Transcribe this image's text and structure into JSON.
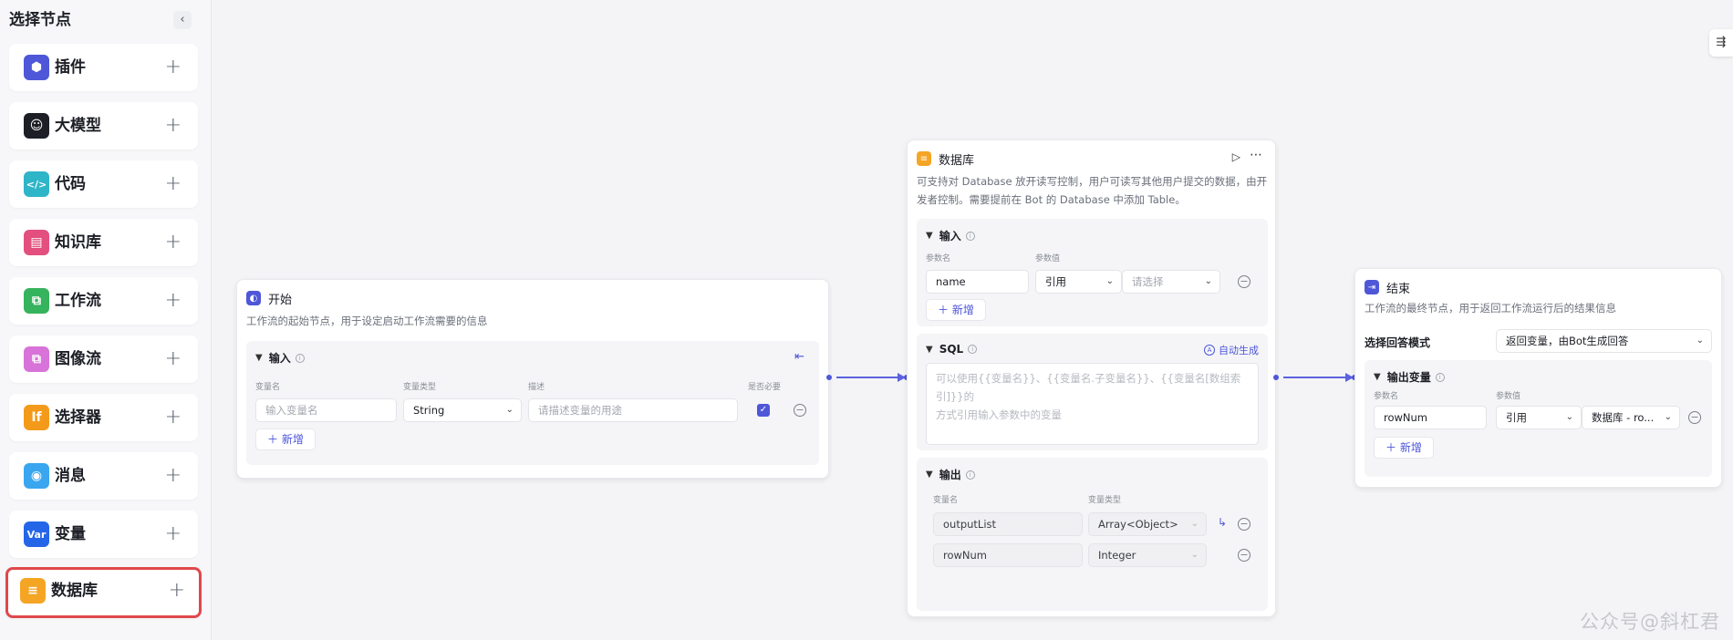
{
  "sidebar": {
    "title": "选择节点",
    "collapse_glyph": "‹",
    "items": [
      {
        "label": "插件",
        "icon": "cube-icon",
        "color": "#4e57d8",
        "glyph": "⬢"
      },
      {
        "label": "大模型",
        "icon": "llm-face-icon",
        "color": "#1d1f26",
        "glyph": "☺"
      },
      {
        "label": "代码",
        "icon": "code-icon",
        "color": "#2fb5c8",
        "glyph": "</>"
      },
      {
        "label": "知识库",
        "icon": "knowledge-icon",
        "color": "#e34f7f",
        "glyph": "▤"
      },
      {
        "label": "工作流",
        "icon": "workflow-icon",
        "color": "#36b35d",
        "glyph": "⧉"
      },
      {
        "label": "图像流",
        "icon": "imageflow-icon",
        "color": "#d873d9",
        "glyph": "⧉"
      },
      {
        "label": "选择器",
        "icon": "if-icon",
        "color": "#f49a1a",
        "glyph": "If"
      },
      {
        "label": "消息",
        "icon": "message-icon",
        "color": "#3aa6ef",
        "glyph": "◉"
      },
      {
        "label": "变量",
        "icon": "var-icon",
        "color": "#2566e8",
        "glyph": "Var"
      },
      {
        "label": "数据库",
        "icon": "database-icon",
        "color": "#f5a524",
        "glyph": "≡"
      }
    ],
    "add_glyph": "+"
  },
  "canvas": {
    "corner_glyph": "⇶",
    "watermark": "公众号@斜杠君"
  },
  "start_node": {
    "title": "开始",
    "desc": "工作流的起始节点，用于设定启动工作流需要的信息",
    "input_title": "输入",
    "cols": [
      "变量名",
      "变量类型",
      "描述",
      "是否必要"
    ],
    "row": {
      "name_placeholder": "输入变量名",
      "type": "String",
      "desc_placeholder": "请描述变量的用途",
      "required": true
    },
    "add_label": "新增"
  },
  "db_node": {
    "title": "数据库",
    "desc_line1": "可支持对 Database 放开读写控制，用户可读写其他用户提交的数据，由开",
    "desc_line2": "发者控制。需要提前在 Bot 的 Database 中添加 Table。",
    "input_title": "输入",
    "input_cols": [
      "参数名",
      "参数值"
    ],
    "input_row": {
      "name": "name",
      "ref": "引用",
      "value_placeholder": "请选择"
    },
    "add_label": "新增",
    "sql_title": "SQL",
    "auto_gen": "自动生成",
    "sql_placeholder_line1": "可以使用{{变量名}}、{{变量名.子变量名}}、{{变量名[数组索引]}}的",
    "sql_placeholder_line2": "方式引用输入参数中的变量",
    "output_title": "输出",
    "output_cols": [
      "变量名",
      "变量类型"
    ],
    "outputs": [
      {
        "name": "outputList",
        "type": "Array<Object>"
      },
      {
        "name": "rowNum",
        "type": "Integer"
      }
    ]
  },
  "end_node": {
    "title": "结束",
    "desc": "工作流的最终节点，用于返回工作流运行后的结果信息",
    "mode_label": "选择回答模式",
    "mode_value": "返回变量，由Bot生成回答",
    "output_title": "输出变量",
    "cols": [
      "参数名",
      "参数值"
    ],
    "row": {
      "name": "rowNum",
      "ref": "引用",
      "value": "数据库 - ro..."
    },
    "add_label": "新增"
  }
}
